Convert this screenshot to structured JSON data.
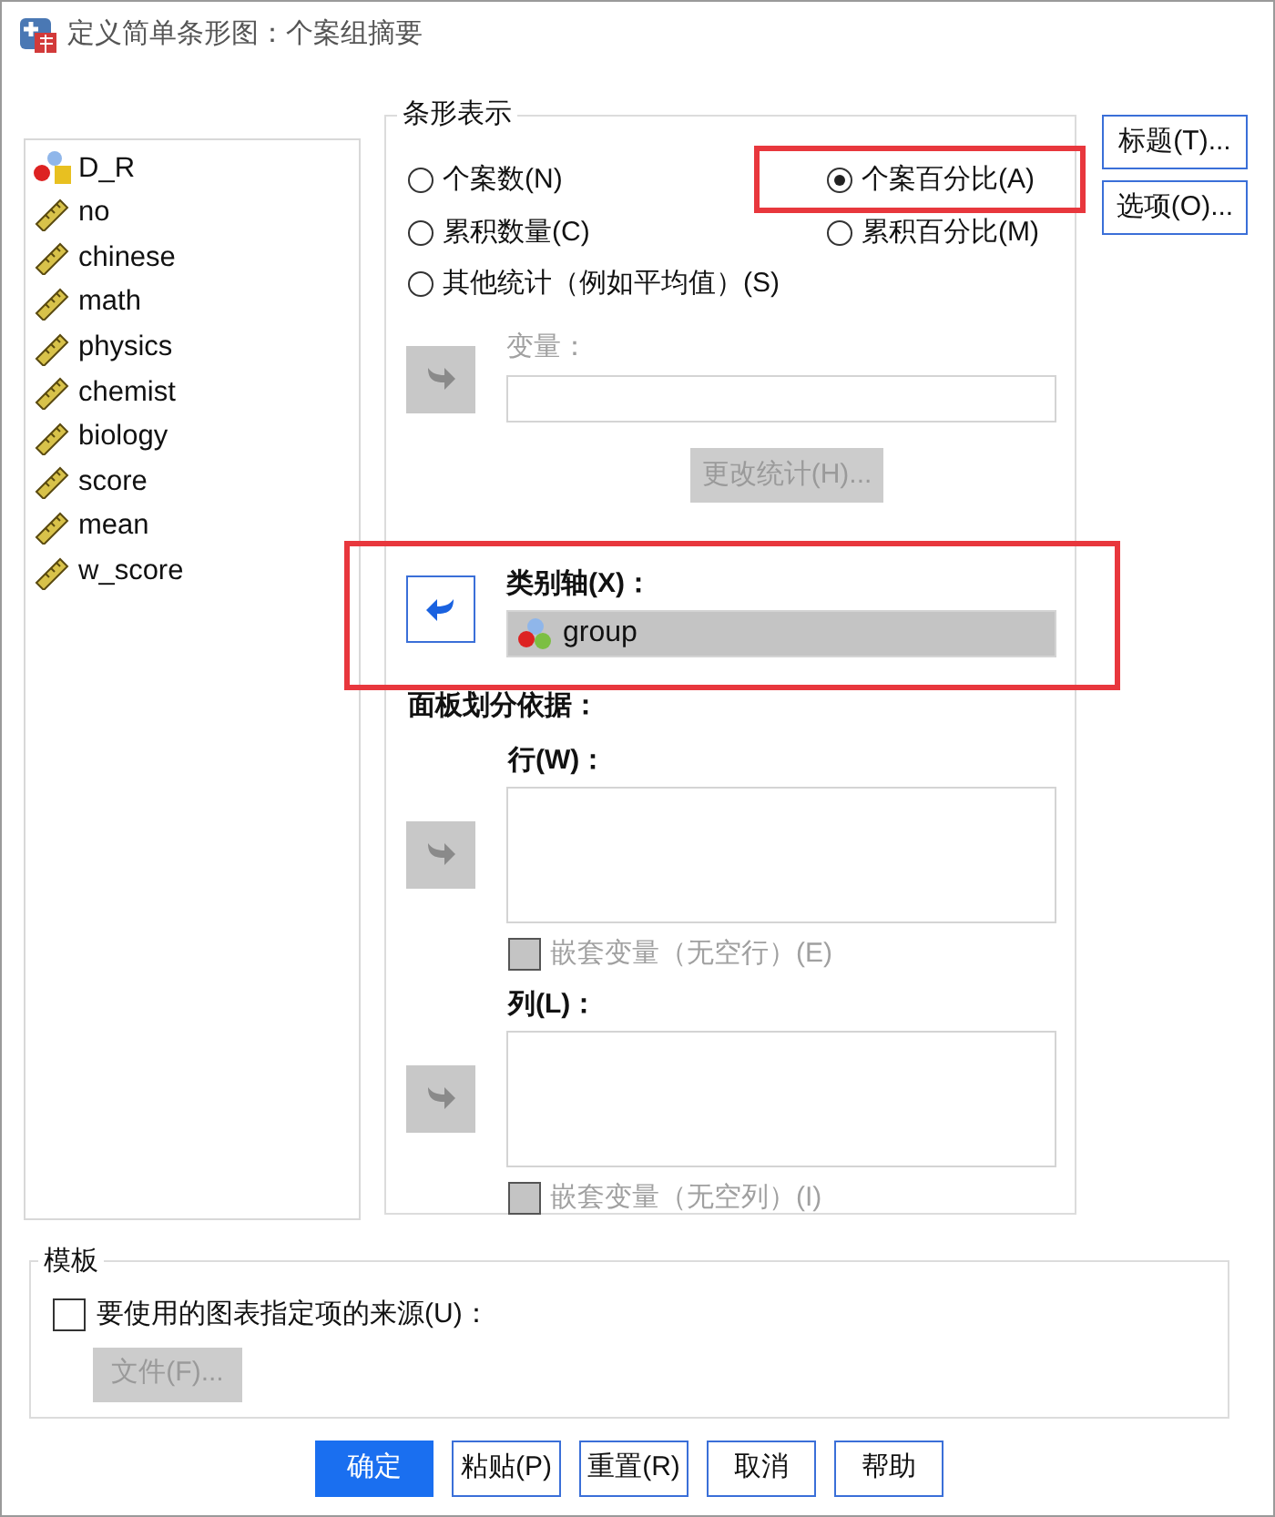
{
  "window": {
    "title": "定义简单条形图：个案组摘要"
  },
  "variables": [
    {
      "name": "D_R",
      "kind": "nominal"
    },
    {
      "name": "no",
      "kind": "scale"
    },
    {
      "name": "chinese",
      "kind": "scale"
    },
    {
      "name": "math",
      "kind": "scale"
    },
    {
      "name": "physics",
      "kind": "scale"
    },
    {
      "name": "chemist",
      "kind": "scale"
    },
    {
      "name": "biology",
      "kind": "scale"
    },
    {
      "name": "score",
      "kind": "scale"
    },
    {
      "name": "mean",
      "kind": "scale"
    },
    {
      "name": "w_score",
      "kind": "scale"
    }
  ],
  "bars_represent": {
    "title": "条形表示",
    "options": [
      {
        "label": "个案数(N)",
        "selected": false,
        "highlighted": false
      },
      {
        "label": "个案百分比(A)",
        "selected": true,
        "highlighted": true
      },
      {
        "label": "累积数量(C)",
        "selected": false,
        "highlighted": false
      },
      {
        "label": "累积百分比(M)",
        "selected": false,
        "highlighted": false
      },
      {
        "label": "其他统计（例如平均值）(S)",
        "selected": false,
        "highlighted": false
      }
    ]
  },
  "summary_variable": {
    "label": "变量：",
    "disabled": true
  },
  "change_statistic": {
    "label": "更改统计(H)...",
    "disabled": true
  },
  "category_axis": {
    "label": "类别轴(X)：",
    "value": "group",
    "disabled": false,
    "highlighted": true
  },
  "panel_by": {
    "title": "面板划分依据：",
    "rows": {
      "label": "行(W)：",
      "disabled": true,
      "nest": {
        "label": "嵌套变量（无空行）(E)",
        "checked": false,
        "disabled": true
      }
    },
    "columns": {
      "label": "列(L)：",
      "disabled": true,
      "nest": {
        "label": "嵌套变量（无空列）(I)",
        "checked": false,
        "disabled": true
      }
    }
  },
  "side_buttons": [
    "标题(T)...",
    "选项(O)..."
  ],
  "template": {
    "title": "模板",
    "use_spec": {
      "label": "要使用的图表指定项的来源(U)：",
      "checked": false
    },
    "file_button": {
      "label": "文件(F)...",
      "disabled": true
    }
  },
  "buttons": [
    {
      "label": "确定",
      "default": true
    },
    {
      "label": "粘贴(P)",
      "default": false
    },
    {
      "label": "重置(R)",
      "default": false
    },
    {
      "label": "取消",
      "default": false
    },
    {
      "label": "帮助",
      "default": false
    }
  ]
}
